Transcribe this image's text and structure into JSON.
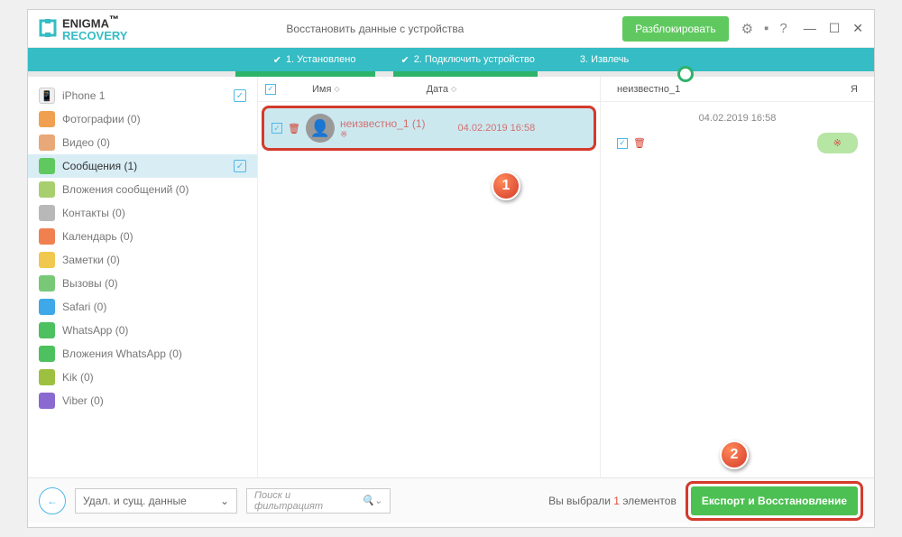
{
  "logo": {
    "line1": "ENIGMA",
    "line2": "RECOVERY",
    "tm": "™"
  },
  "header": {
    "subtitle": "Восстановить данные с устройства",
    "unlock": "Разблокировать"
  },
  "steps": {
    "s1": "1. Установлено",
    "s2": "2. Подключить устройство",
    "s3": "3. Извлечь"
  },
  "sidebar": {
    "device": "iPhone 1",
    "items": [
      {
        "label": "Фотографии (0)",
        "color": "#f0a050"
      },
      {
        "label": "Видео (0)",
        "color": "#e8a878"
      },
      {
        "label": "Сообщения  (1)",
        "color": "#5fc95f",
        "selected": true
      },
      {
        "label": "Вложения сообщений (0)",
        "color": "#a8cf6e"
      },
      {
        "label": "Контакты (0)",
        "color": "#b8b8b8"
      },
      {
        "label": "Календарь (0)",
        "color": "#f08050"
      },
      {
        "label": "Заметки (0)",
        "color": "#f0c850"
      },
      {
        "label": "Вызовы (0)",
        "color": "#78c878"
      },
      {
        "label": "Safari (0)",
        "color": "#3fa8e8"
      },
      {
        "label": "WhatsApp (0)",
        "color": "#4dc060"
      },
      {
        "label": "Вложения WhatsApp (0)",
        "color": "#4dc060"
      },
      {
        "label": "Kik (0)",
        "color": "#9ec040"
      },
      {
        "label": "Viber (0)",
        "color": "#8a6ad0"
      }
    ]
  },
  "mid": {
    "col_name": "Имя",
    "col_date": "Дата",
    "row": {
      "name": "неизвестно_1 (1)",
      "date": "04.02.2019 16:58",
      "extra": "※"
    }
  },
  "right": {
    "title": "неизвестно_1",
    "me": "Я",
    "msg_date": "04.02.2019 16:58",
    "bubble": "※"
  },
  "footer": {
    "dropdown": "Удал. и сущ. данные",
    "search_placeholder": "Поиск и фильтрацият",
    "selected_pre": "Вы выбрали ",
    "selected_n": "1",
    "selected_post": " элементов",
    "export": "Експорт и Восстановление"
  },
  "callouts": {
    "c1": "1",
    "c2": "2"
  }
}
